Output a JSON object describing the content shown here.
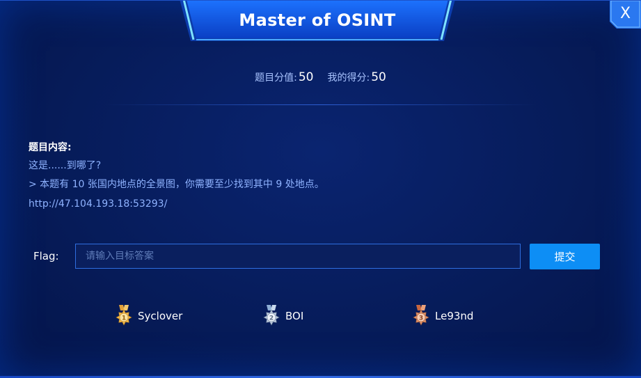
{
  "dialog": {
    "title": "Master of OSINT",
    "close_label": "X"
  },
  "score": {
    "challenge_label": "题目分值:",
    "challenge_value": "50",
    "my_label": "我的得分:",
    "my_value": "50"
  },
  "content": {
    "heading": "题目内容:",
    "lines": [
      "这是......到哪了?",
      "> 本题有 10 张国内地点的全景图，你需要至少找到其中 9 处地点。"
    ],
    "link": "http://47.104.193.18:53293/"
  },
  "flag": {
    "label": "Flag:",
    "placeholder": "请输入目标答案",
    "value": "",
    "submit_label": "提交"
  },
  "ranking": [
    {
      "rank": "1",
      "name": "Syclover",
      "medal": "gold-medal-icon",
      "color": "#f2b84b"
    },
    {
      "rank": "2",
      "name": "BOI",
      "medal": "silver-medal-icon",
      "color": "#b9c7dc"
    },
    {
      "rank": "3",
      "name": "Le93nd",
      "medal": "bronze-medal-icon",
      "color": "#e0926a"
    }
  ],
  "colors": {
    "background": "#061b58",
    "accent": "#0d8ef5",
    "text_muted": "#8fb3ff"
  }
}
